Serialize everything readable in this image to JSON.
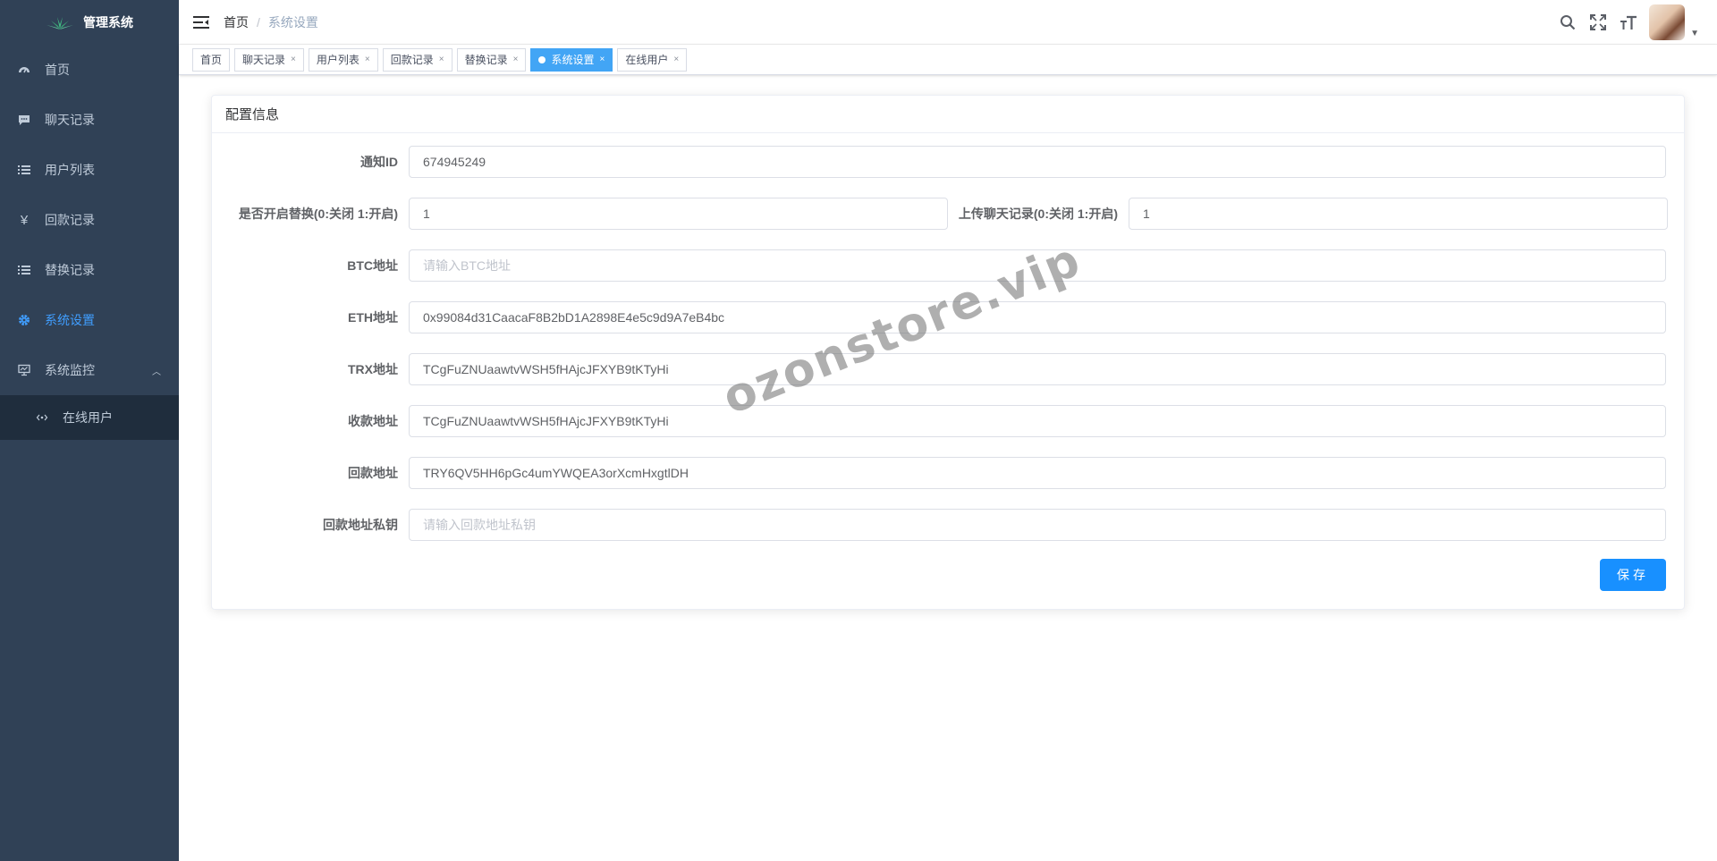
{
  "app": {
    "title": "管理系统"
  },
  "sidebar": {
    "items": [
      {
        "label": "首页",
        "icon": "dashboard-icon"
      },
      {
        "label": "聊天记录",
        "icon": "chat-icon"
      },
      {
        "label": "用户列表",
        "icon": "list-icon"
      },
      {
        "label": "回款记录",
        "icon": "yen-icon"
      },
      {
        "label": "替换记录",
        "icon": "list-icon"
      },
      {
        "label": "系统设置",
        "icon": "gear-icon",
        "active": true
      },
      {
        "label": "系统监控",
        "icon": "monitor-icon",
        "expanded": true
      }
    ],
    "sub_items": [
      {
        "label": "在线用户",
        "icon": "online-icon"
      }
    ]
  },
  "breadcrumb": {
    "home": "首页",
    "separator": "/",
    "current": "系统设置"
  },
  "tags": [
    {
      "label": "首页",
      "closable": false
    },
    {
      "label": "聊天记录",
      "closable": true
    },
    {
      "label": "用户列表",
      "closable": true
    },
    {
      "label": "回款记录",
      "closable": true
    },
    {
      "label": "替换记录",
      "closable": true
    },
    {
      "label": "系统设置",
      "closable": true,
      "active": true
    },
    {
      "label": "在线用户",
      "closable": true
    }
  ],
  "tag_close": "×",
  "card": {
    "title": "配置信息"
  },
  "form": {
    "notify_id": {
      "label": "通知ID",
      "value": "674945249"
    },
    "enable_replace": {
      "label": "是否开启替换(0:关闭 1:开启)",
      "value": "1"
    },
    "upload_chat": {
      "label": "上传聊天记录(0:关闭 1:开启)",
      "value": "1"
    },
    "btc": {
      "label": "BTC地址",
      "value": "",
      "placeholder": "请输入BTC地址"
    },
    "eth": {
      "label": "ETH地址",
      "value": "0x99084d31CaacaF8B2bD1A2898E4e5c9d9A7eB4bc"
    },
    "trx": {
      "label": "TRX地址",
      "value": "TCgFuZNUaawtvWSH5fHAjcJFXYB9tKTyHi"
    },
    "receive": {
      "label": "收款地址",
      "value": "TCgFuZNUaawtvWSH5fHAjcJFXYB9tKTyHi"
    },
    "refund": {
      "label": "回款地址",
      "value": "TRY6QV5HH6pGc4umYWQEA3orXcmHxgtlDH"
    },
    "refund_key": {
      "label": "回款地址私钥",
      "value": "",
      "placeholder": "请输入回款地址私钥"
    }
  },
  "buttons": {
    "save": "保存"
  },
  "watermark": "ozonstore.vip",
  "colors": {
    "sidebar_bg": "#304156",
    "submenu_bg": "#1f2d3d",
    "active": "#409eff",
    "active_tag": "#42a5f5",
    "primary_button": "#1890ff"
  }
}
